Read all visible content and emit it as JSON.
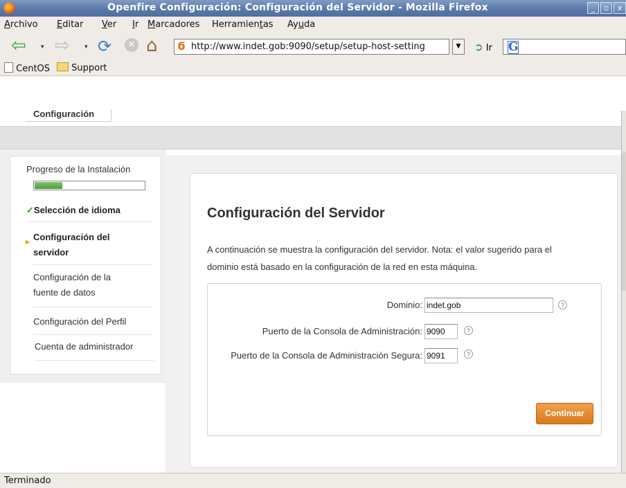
{
  "window": {
    "title": "Openfire Configuración: Configuración del Servidor - Mozilla Firefox",
    "minimize_glyph": "_",
    "maximize_glyph": "▫",
    "close_glyph": "x"
  },
  "menu": [
    {
      "pre": "",
      "u": "A",
      "post": "rchivo"
    },
    {
      "pre": "",
      "u": "E",
      "post": "ditar"
    },
    {
      "pre": "",
      "u": "V",
      "post": "er"
    },
    {
      "pre": "",
      "u": "I",
      "post": "r"
    },
    {
      "pre": "",
      "u": "M",
      "post": "arcadores"
    },
    {
      "pre": "Herramien",
      "u": "t",
      "post": "as"
    },
    {
      "pre": "Ay",
      "u": "u",
      "post": "da"
    }
  ],
  "nav": {
    "url": "http://www.indet.gob:9090/setup/setup-host-setting",
    "go_label": "Ir",
    "search_engine_glyph": "G"
  },
  "bookmarks": [
    {
      "label": "CentOS",
      "icon": "page-icon"
    },
    {
      "label": "Support",
      "icon": "folder-icon"
    }
  ],
  "page": {
    "header_tab": "Configuración",
    "sidebar": {
      "progress_label": "Progreso de la Instalación",
      "progress_fraction": 0.25,
      "steps": [
        {
          "label": "Selección de idioma",
          "state": "done"
        },
        {
          "label_line1": "Configuración del",
          "label_line2": "servidor",
          "state": "current"
        },
        {
          "label_line1": "Configuración de la",
          "label_line2": "fuente de datos",
          "state": "pending"
        },
        {
          "label": "Configuración del Perfil",
          "state": "pending"
        },
        {
          "label": "Cuenta de administrador",
          "state": "pending"
        }
      ]
    },
    "main": {
      "title": "Configuración del Servidor",
      "intro_line1": "A continuación se muestra la configuración del servidor. Nota: el valor sugerido para el",
      "intro_line2": "dominio está basado en la configuración de la red en esta máquina.",
      "fields": [
        {
          "label": "Dominio:",
          "value": "indet.gob"
        },
        {
          "label": "Puerto de la Consola de Administración:",
          "value": "9090"
        },
        {
          "label": "Puerto de la Consola de Administración Segura:",
          "value": "9091"
        }
      ],
      "help_glyph": "?",
      "continue_label": "Continuar"
    }
  },
  "status": "Terminado",
  "colors": {
    "accent_button": "#e08a2c",
    "progress_green": "#5aa946",
    "titlebar_blue": "#5a79aa"
  }
}
